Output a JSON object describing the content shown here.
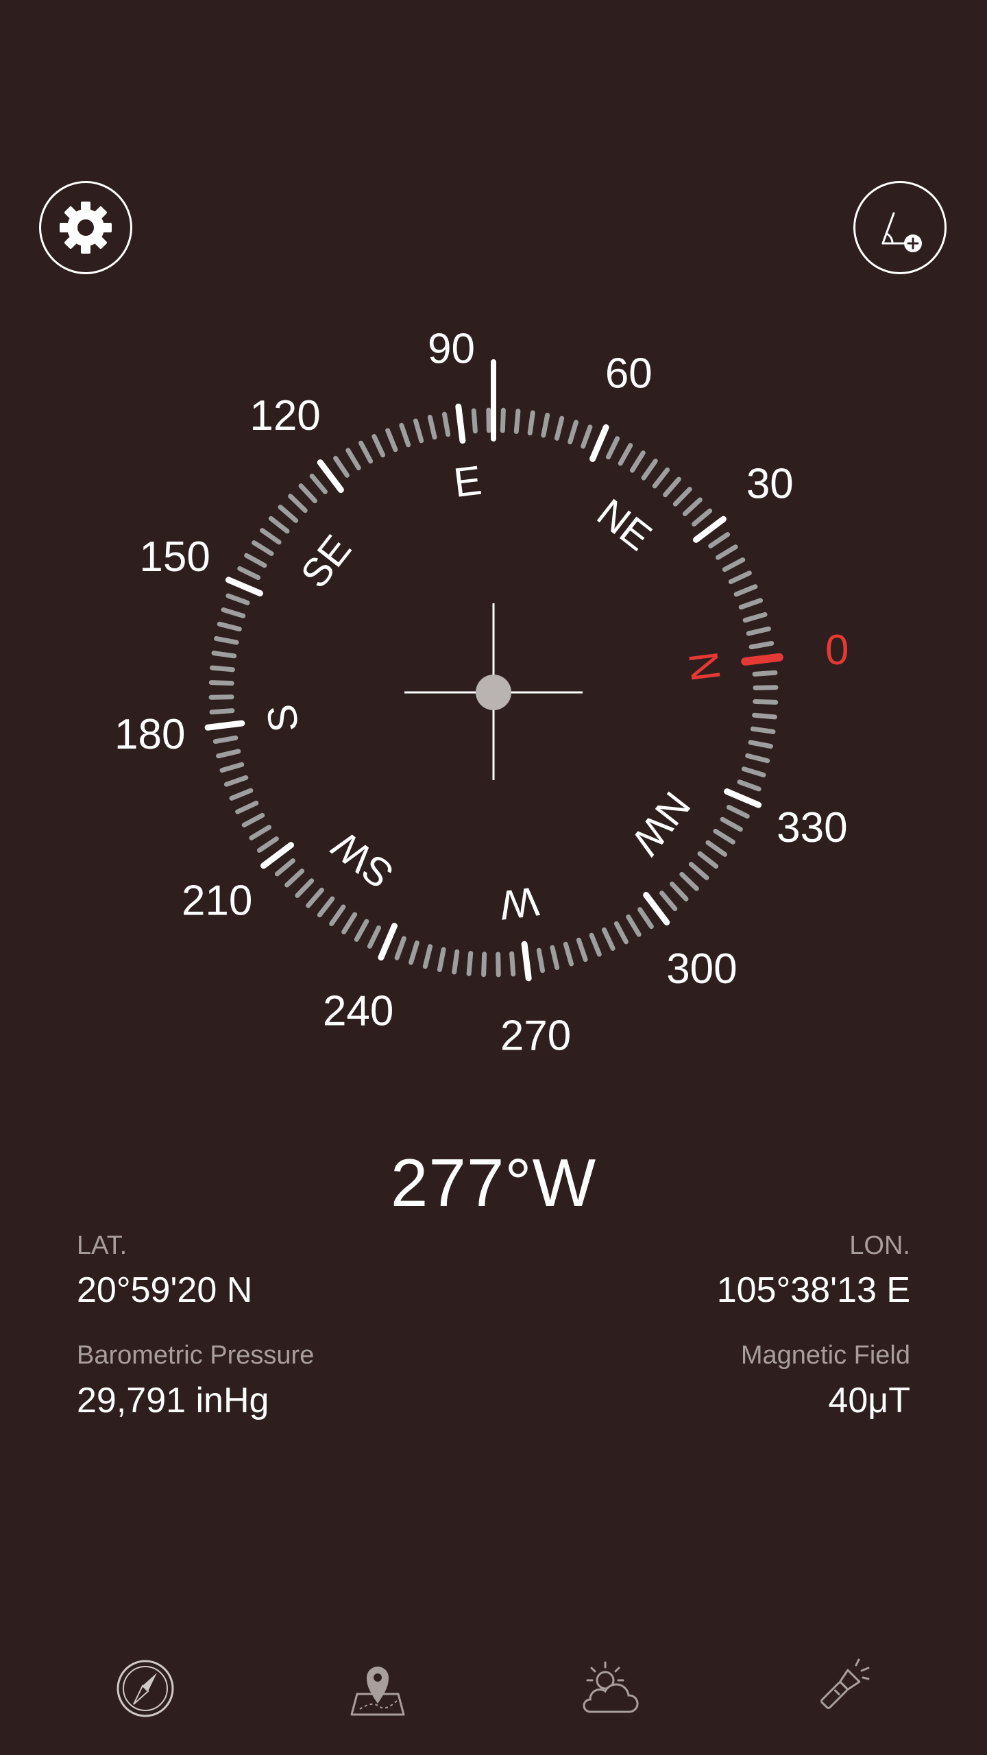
{
  "heading": "277°W",
  "ring_labels": [
    "270",
    "300",
    "330",
    "0",
    "30",
    "60",
    "90",
    "120",
    "150",
    "180",
    "210",
    "240"
  ],
  "cardinals": [
    "N",
    "NE",
    "E",
    "SE",
    "S",
    "SW",
    "W",
    "NW"
  ],
  "info": {
    "lat_label": "LAT.",
    "lat_value": "20°59'20 N",
    "lon_label": "LON.",
    "lon_value": "105°38'13 E",
    "pressure_label": "Barometric Pressure",
    "pressure_value": "29,791 inHg",
    "magnetic_label": "Magnetic Field",
    "magnetic_value": "40μT"
  },
  "icons": {
    "settings": "gear-icon",
    "angle": "angle-add-icon",
    "nav": [
      "compass-icon",
      "map-pin-icon",
      "weather-icon",
      "flashlight-icon"
    ]
  },
  "colors": {
    "background": "#2e1f1e",
    "north": "#e53935",
    "tick_minor": "#9e9e9e",
    "tick_major": "#ffffff",
    "label_muted": "#a89e9c"
  }
}
